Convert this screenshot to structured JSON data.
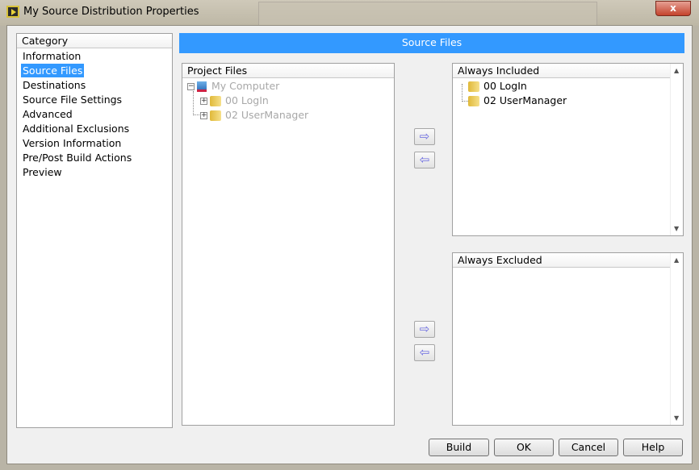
{
  "window": {
    "title": "My Source Distribution Properties",
    "close_label": "x"
  },
  "category": {
    "header": "Category",
    "items": [
      "Information",
      "Source Files",
      "Destinations",
      "Source File Settings",
      "Advanced",
      "Additional Exclusions",
      "Version Information",
      "Pre/Post Build Actions",
      "Preview"
    ],
    "selected": "Source Files"
  },
  "section_title": "Source Files",
  "project_files": {
    "header": "Project Files",
    "root": "My Computer",
    "children": [
      "00 LogIn",
      "02 UserManager"
    ]
  },
  "always_included": {
    "header": "Always Included",
    "items": [
      "00 LogIn",
      "02 UserManager"
    ]
  },
  "always_excluded": {
    "header": "Always Excluded",
    "items": []
  },
  "arrows": {
    "right": "⇨",
    "left": "⇦"
  },
  "buttons": {
    "build": "Build",
    "ok": "OK",
    "cancel": "Cancel",
    "help": "Help"
  },
  "colors": {
    "accent": "#3399ff"
  }
}
